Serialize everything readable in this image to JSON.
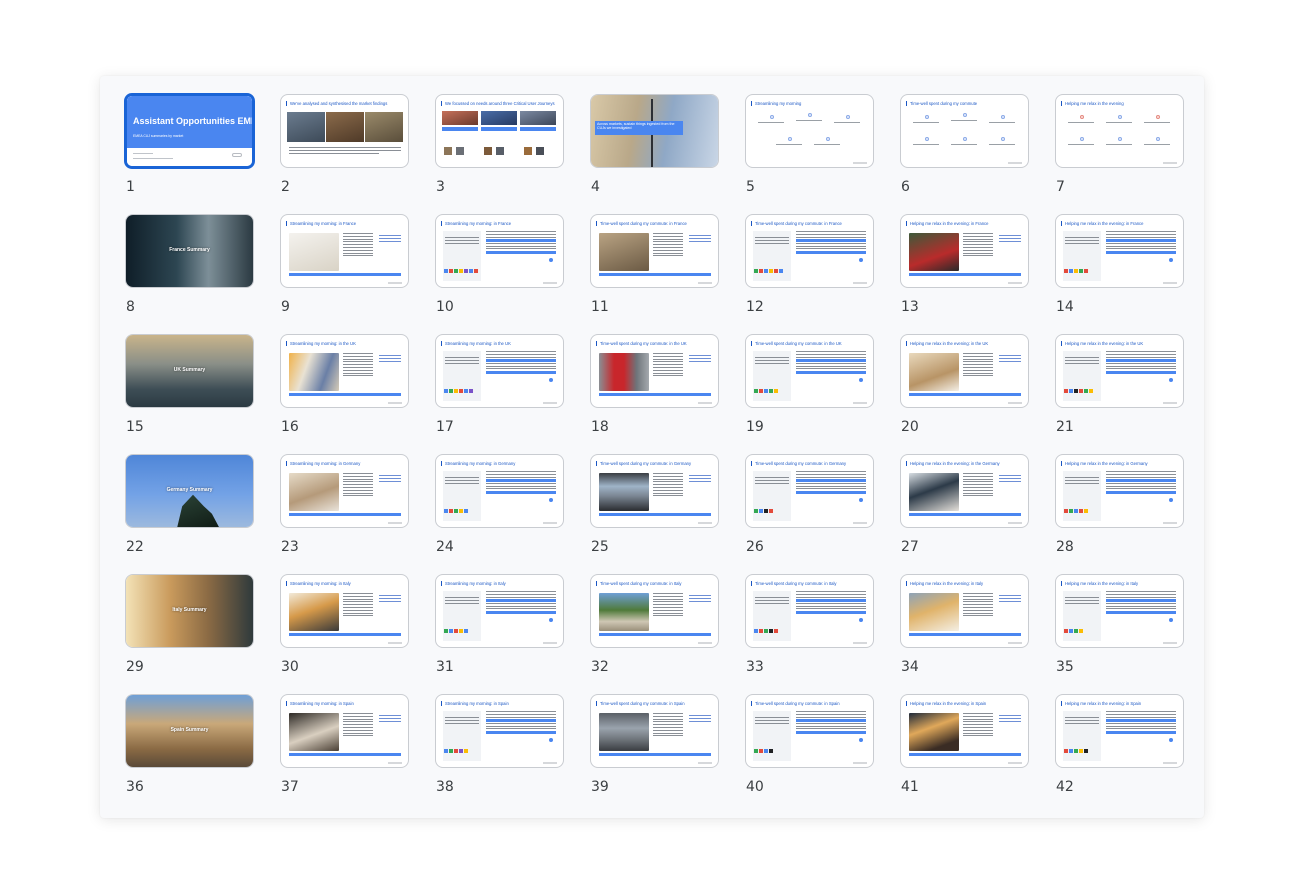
{
  "deck": {
    "slide1": {
      "title": "Assistant Opportunities EMEA",
      "subtitle": "EMEA CUJ summaries by market"
    },
    "slide2": {
      "title": "We've analysed and synthesised the market findings"
    },
    "slide3": {
      "title": "We focussed on needs around three Critical User Journeys"
    },
    "slide4": {
      "caption": "Across markets, sustain things ingested from the CUJs we investigated"
    },
    "slide5": {
      "title": "Streamlining my morning"
    },
    "slide6": {
      "title": "Time-well spent during my commute"
    },
    "slide7": {
      "title": "Helping me relax in the evening"
    },
    "summaries": {
      "s8": "France Summary",
      "s15": "UK Summary",
      "s22": "Germany Summary",
      "s29": "Italy Summary",
      "s36": "Spain Summary"
    },
    "slide_titles": {
      "s9": "Streamlining my morning: in France",
      "s10": "Streamlining my morning: in France",
      "s11": "Time-well spent during my commute: in France",
      "s12": "Time-well spent during my commute: in France",
      "s13": "Helping me relax in the evening: in France",
      "s14": "Helping me relax in the evening: in France",
      "s16": "Streamlining my morning: in the UK",
      "s17": "Streamlining my morning: in the UK",
      "s18": "Time-well spent during my commute: in the UK",
      "s19": "Time-well spent during my commute: in the UK",
      "s20": "Helping me relax in the evening: in the UK",
      "s21": "Helping me relax in the evening: in the UK",
      "s23": "Streamlining my morning: in Germany",
      "s24": "Streamlining my morning: in Germany",
      "s25": "Time-well spent during my commute: in Germany",
      "s26": "Time-well spent during my commute: in Germany",
      "s27": "Helping me relax in the evening: in the Germany",
      "s28": "Helping me relax in the evening: in Germany",
      "s30": "Streamlining my morning: in Italy",
      "s31": "Streamlining my morning: in Italy",
      "s32": "Time-well spent during my commute: in Italy",
      "s33": "Time-well spent during my commute: in Italy",
      "s34": "Helping me relax in the evening: in Italy",
      "s35": "Helping me relax in the evening: in Italy",
      "s37": "Streamlining my morning: in Spain",
      "s38": "Streamlining my morning: in Spain",
      "s39": "Time-well spent during my commute: in Spain",
      "s40": "Time-well spent during my commute: in Spain",
      "s41": "Helping me relax in the evening: in Spain",
      "s42": "Helping me relax in the evening: in Spain"
    },
    "numbers": [
      "1",
      "2",
      "3",
      "4",
      "5",
      "6",
      "7",
      "8",
      "9",
      "10",
      "11",
      "12",
      "13",
      "14",
      "15",
      "16",
      "17",
      "18",
      "19",
      "20",
      "21",
      "22",
      "23",
      "24",
      "25",
      "26",
      "27",
      "28",
      "29",
      "30",
      "31",
      "32",
      "33",
      "34",
      "35",
      "36",
      "37",
      "38",
      "39",
      "40",
      "41",
      "42"
    ]
  },
  "colors": {
    "accent": "#4a86f0",
    "selection": "#1a64d6",
    "title_blue": "#1a56c4"
  },
  "selected_slide": "1"
}
